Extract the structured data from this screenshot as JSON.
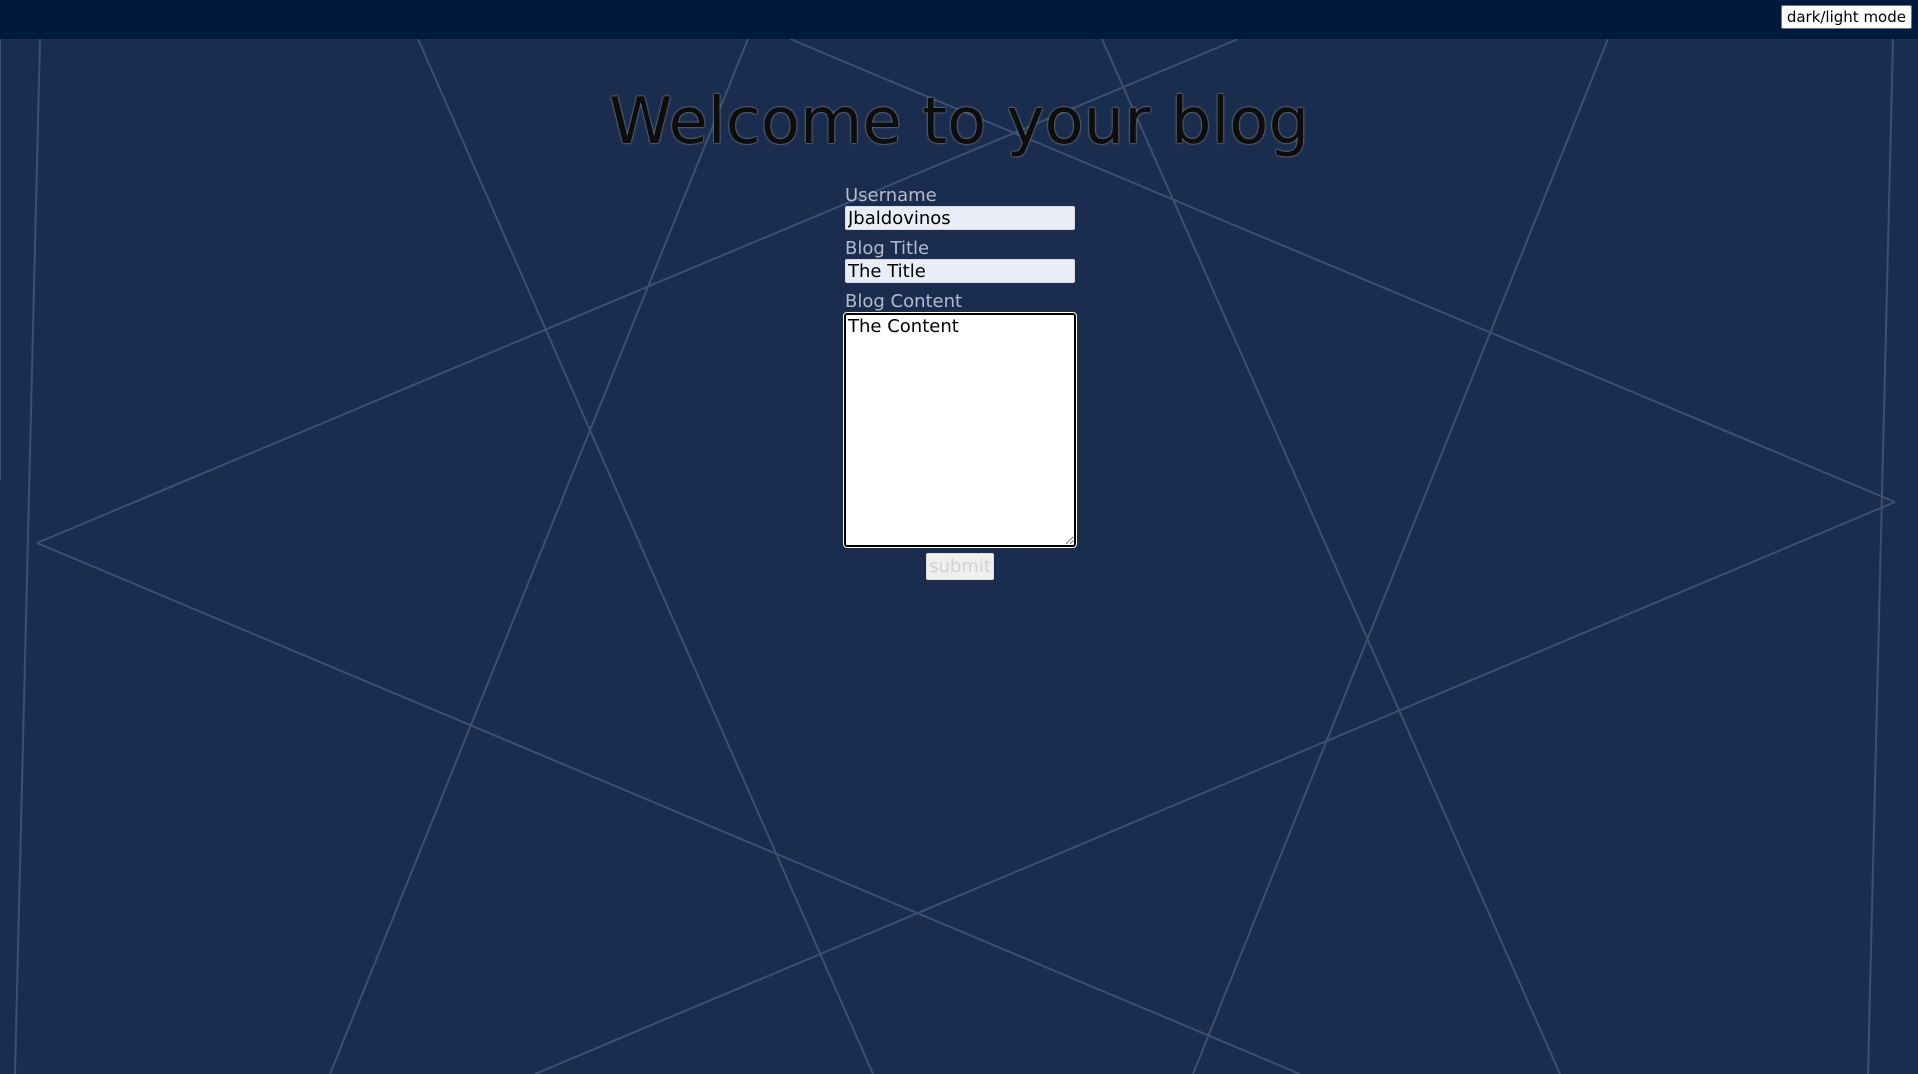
{
  "header": {
    "mode_toggle_label": "dark/light mode"
  },
  "main": {
    "title": "Welcome to your blog",
    "form": {
      "username_label": "Username",
      "username_value": "Jbaldovinos",
      "blog_title_label": "Blog Title",
      "blog_title_value": "The Title",
      "blog_content_label": "Blog Content",
      "blog_content_value": "The Content",
      "submit_label": "submit"
    }
  },
  "colors": {
    "background": "#1a2d4f",
    "topbar": "#001a3d",
    "background_lines": "#3a5074",
    "label_text": "#b3bccb"
  }
}
